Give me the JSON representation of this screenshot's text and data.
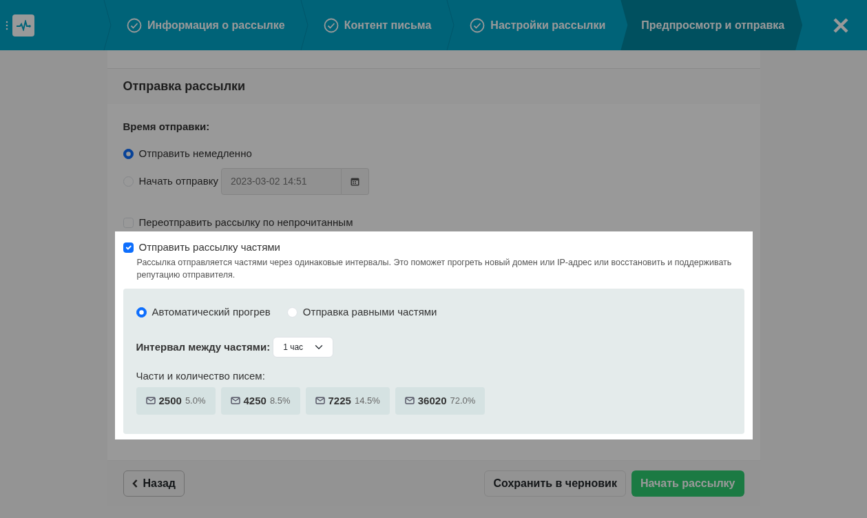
{
  "header": {
    "steps": [
      {
        "label": "Информация о рассылке",
        "done": true,
        "selected": false
      },
      {
        "label": "Контент письма",
        "done": true,
        "selected": false
      },
      {
        "label": "Настройки рассылки",
        "done": true,
        "selected": false
      },
      {
        "label": "Предпросмотр и отправка",
        "done": false,
        "selected": true
      }
    ]
  },
  "card": {
    "title": "Отправка рассылки",
    "send_time": {
      "label": "Время отправки:",
      "options": [
        {
          "label": "Отправить немедленно",
          "selected": true
        },
        {
          "label": "Начать отправку",
          "selected": false
        }
      ],
      "datetime": {
        "value": "2023-03-02 14:51",
        "disabled": true
      }
    },
    "resend": {
      "label": "Переотправить рассылку по непрочитанным",
      "checked": false
    },
    "split": {
      "label": "Отправить рассылку частями",
      "checked": true,
      "help": "Рассылка отправляется частями через одинаковые интервалы. Это поможет прогреть новый домен или IP-адрес или восстановить и поддерживать репутацию отправителя.",
      "modes": [
        {
          "label": "Автоматический прогрев",
          "selected": true
        },
        {
          "label": "Отправка равными частями",
          "selected": false
        }
      ],
      "interval": {
        "label": "Интервал между частями:",
        "value": "1 час"
      },
      "parts_label": "Части и количество писем:",
      "parts": [
        {
          "count": "2500",
          "percent": "5.0%"
        },
        {
          "count": "4250",
          "percent": "8.5%"
        },
        {
          "count": "7225",
          "percent": "14.5%"
        },
        {
          "count": "36020",
          "percent": "72.0%"
        }
      ]
    }
  },
  "footer": {
    "back": "Назад",
    "save": "Сохранить в черновик",
    "start": "Начать рассылку"
  }
}
